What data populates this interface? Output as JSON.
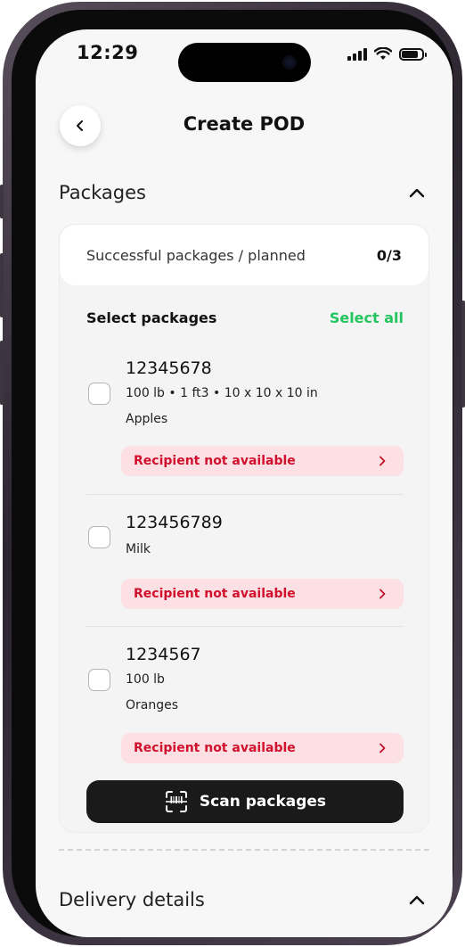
{
  "status_bar": {
    "time": "12:29"
  },
  "header": {
    "title": "Create POD",
    "back_icon": "chevron-left-icon"
  },
  "packages_section": {
    "title": "Packages",
    "summary": {
      "label": "Successful packages / planned",
      "count": "0/3"
    },
    "select_label": "Select packages",
    "select_all_label": "Select all",
    "items": [
      {
        "id": "12345678",
        "details": "100 lb • 1 ft3 • 10 x 10 x 10 in",
        "description": "Apples",
        "alert": "Recipient not available"
      },
      {
        "id": "123456789",
        "description": "Milk",
        "alert": "Recipient not available"
      },
      {
        "id": "1234567",
        "details": "100 lb",
        "description": "Oranges",
        "alert": "Recipient not available"
      }
    ],
    "scan_button_label": "Scan packages"
  },
  "delivery_section": {
    "title": "Delivery details"
  },
  "colors": {
    "accent_green": "#22c55e",
    "alert_red": "#d0102c",
    "alert_bg": "#fde0e4",
    "button_dark": "#1a1a1a"
  }
}
